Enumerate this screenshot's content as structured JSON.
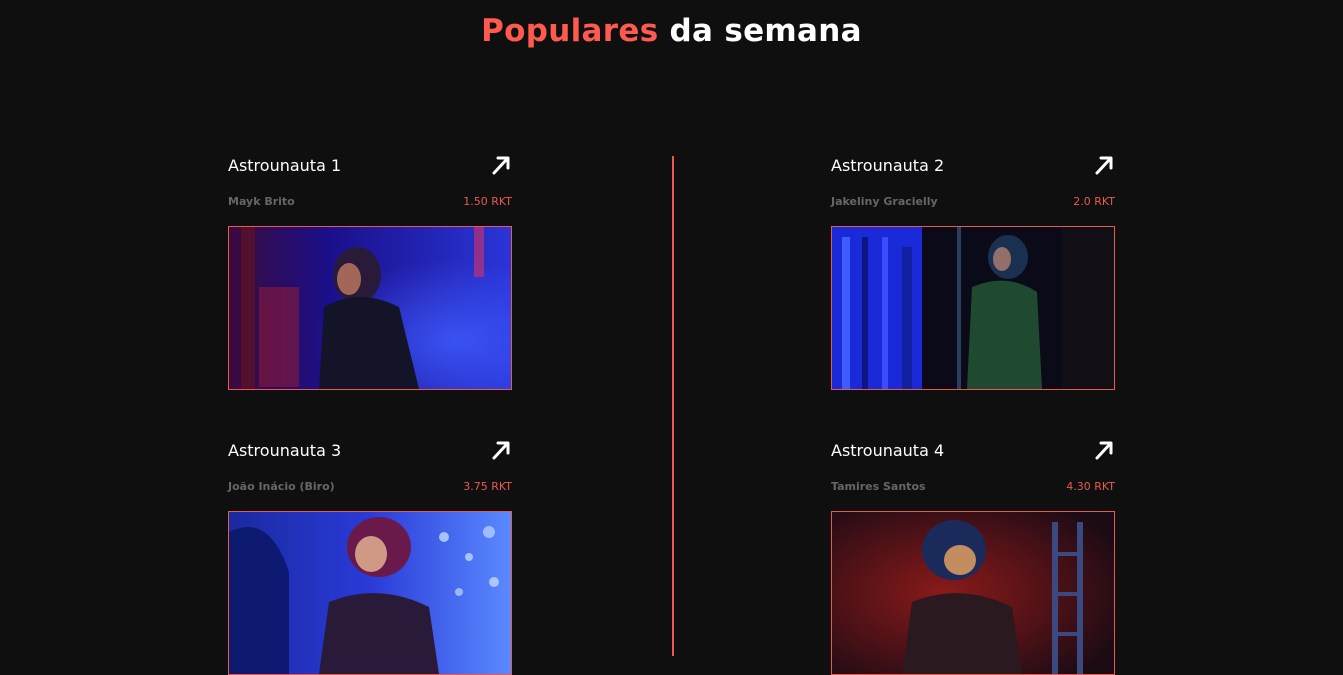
{
  "section": {
    "title_accent": "Populares",
    "title_rest": " da semana"
  },
  "colors": {
    "background": "#0f0f0f",
    "accent": "#e85a4f",
    "text": "#ffffff",
    "muted": "#666666"
  },
  "cards": [
    {
      "name": "Astrounauta 1",
      "author": "Mayk Brito",
      "price": "1.50 RKT",
      "icon": "arrow-up-right-icon"
    },
    {
      "name": "Astrounauta 2",
      "author": "Jakeliny Gracielly",
      "price": "2.0 RKT",
      "icon": "arrow-up-right-icon"
    },
    {
      "name": "Astrounauta 3",
      "author": "João Inácio (Biro)",
      "price": "3.75 RKT",
      "icon": "arrow-up-right-icon"
    },
    {
      "name": "Astrounauta 4",
      "author": "Tamires Santos",
      "price": "4.30 RKT",
      "icon": "arrow-up-right-icon"
    }
  ]
}
